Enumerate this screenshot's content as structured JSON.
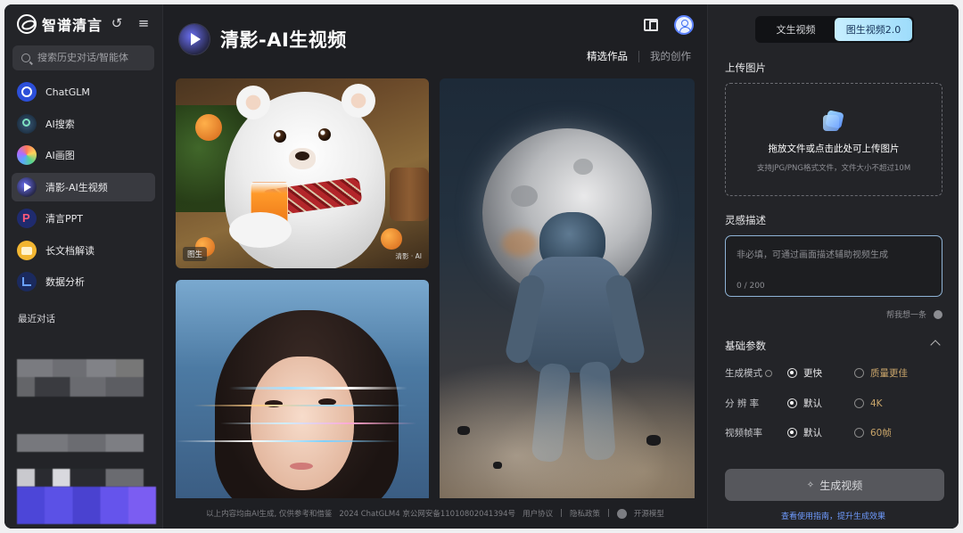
{
  "brand": {
    "name": "智谱清言"
  },
  "search": {
    "placeholder": "搜索历史对话/智能体"
  },
  "sidebar": {
    "items": [
      {
        "label": "ChatGLM"
      },
      {
        "label": "AI搜索"
      },
      {
        "label": "AI画图"
      },
      {
        "label": "清影-AI生视频"
      },
      {
        "label": "清言PPT"
      },
      {
        "label": "长文档解读"
      },
      {
        "label": "数据分析"
      }
    ],
    "recent_label": "最近对话"
  },
  "main": {
    "title": "清影-AI生视频",
    "tabs": [
      {
        "label": "精选作品"
      },
      {
        "label": "我的创作"
      }
    ],
    "card1_tag": "图生",
    "card1_wm": "清影 · AI",
    "footer": {
      "disclaimer": "以上内容均由AI生成, 仅供参考和借鉴",
      "icp": "2024 ChatGLM4 京公网安备11010802041394号",
      "agreement": "用户协议",
      "privacy": "隐私政策",
      "opensource": "开源模型"
    }
  },
  "panel": {
    "modes": [
      {
        "label": "文生视频"
      },
      {
        "label": "图生视频2.0"
      }
    ],
    "upload_title": "上传图片",
    "upload_main": "拖放文件或点击此处可上传图片",
    "upload_sub": "支持JPG/PNG格式文件，文件大小不超过10M",
    "inspire_title": "灵感描述",
    "inspire_placeholder": "非必填，可通过画面描述辅助视频生成",
    "inspire_count": "0 / 200",
    "help_label": "帮我想一条",
    "params_title": "基础参数",
    "rows": [
      {
        "label": "生成模式",
        "opt1": "更快",
        "opt2": "质量更佳"
      },
      {
        "label": "分 辨 率",
        "opt1": "默认",
        "opt2": "4K"
      },
      {
        "label": "视频帧率",
        "opt1": "默认",
        "opt2": "60帧"
      }
    ],
    "generate_label": "生成视频",
    "guide_label": "查看使用指南，提升生成效果"
  }
}
